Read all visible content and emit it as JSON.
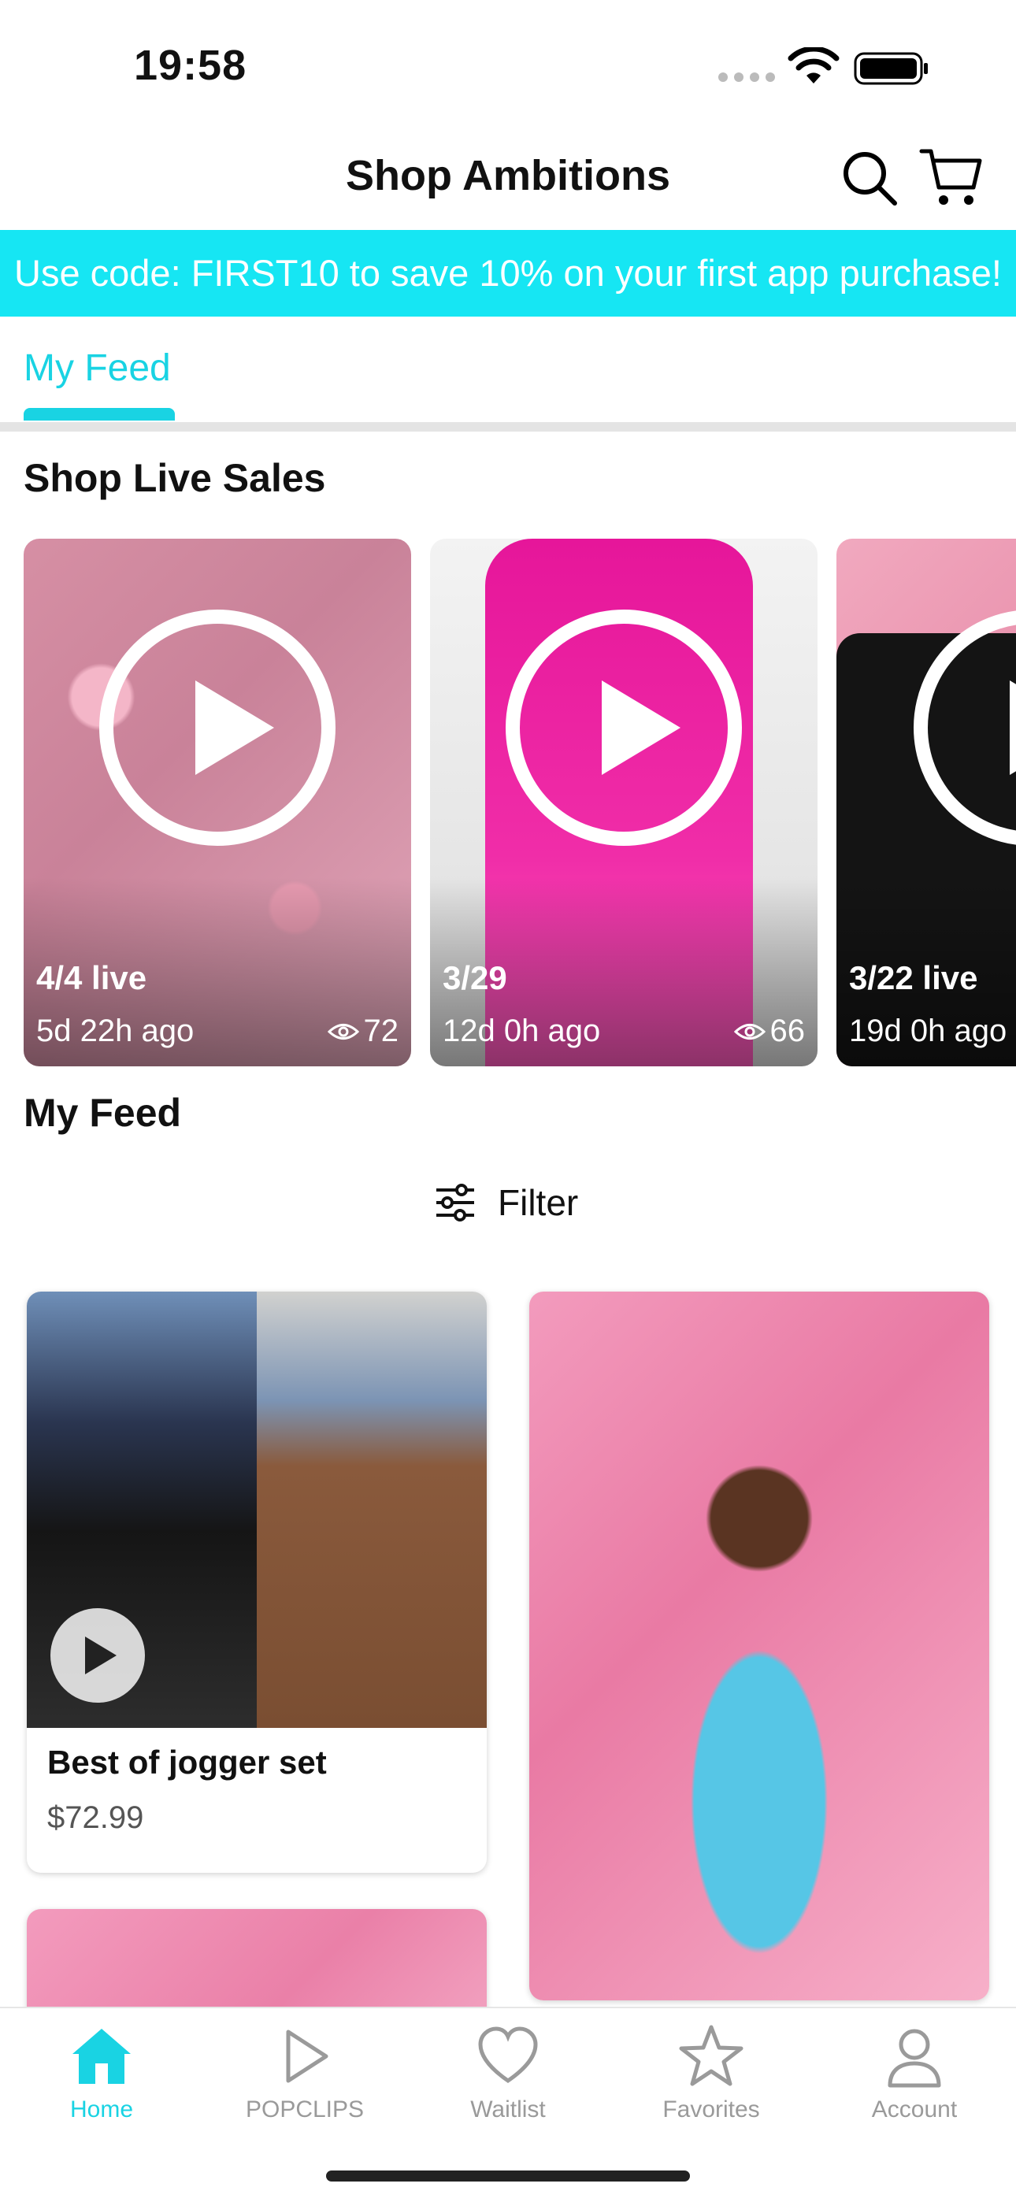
{
  "status_bar": {
    "time": "19:58"
  },
  "header": {
    "title": "Shop Ambitions",
    "icons": [
      "search-icon",
      "cart-icon"
    ]
  },
  "promo": {
    "text": "Use code: FIRST10 to save 10% on your first app purchase!"
  },
  "tabs": {
    "active": "My Feed"
  },
  "live_sales": {
    "title": "Shop Live Sales",
    "cards": [
      {
        "label": "4/4 live",
        "ago": "5d 22h ago",
        "views": "72"
      },
      {
        "label": "3/29",
        "ago": "12d 0h ago",
        "views": "66"
      },
      {
        "label": "3/22 live",
        "ago": "19d 0h ago",
        "views": ""
      }
    ]
  },
  "feed": {
    "title": "My Feed",
    "filter_label": "Filter",
    "products": [
      {
        "name": "Best of jogger set",
        "price": "$72.99"
      }
    ]
  },
  "tab_bar": {
    "items": [
      {
        "label": "Home",
        "icon": "home-icon",
        "active": true
      },
      {
        "label": "POPCLIPS",
        "icon": "play-icon",
        "active": false
      },
      {
        "label": "Waitlist",
        "icon": "heart-icon",
        "active": false
      },
      {
        "label": "Favorites",
        "icon": "star-icon",
        "active": false
      },
      {
        "label": "Account",
        "icon": "person-icon",
        "active": false
      }
    ]
  },
  "colors": {
    "accent": "#19d3e3",
    "banner": "#16e6f3"
  }
}
